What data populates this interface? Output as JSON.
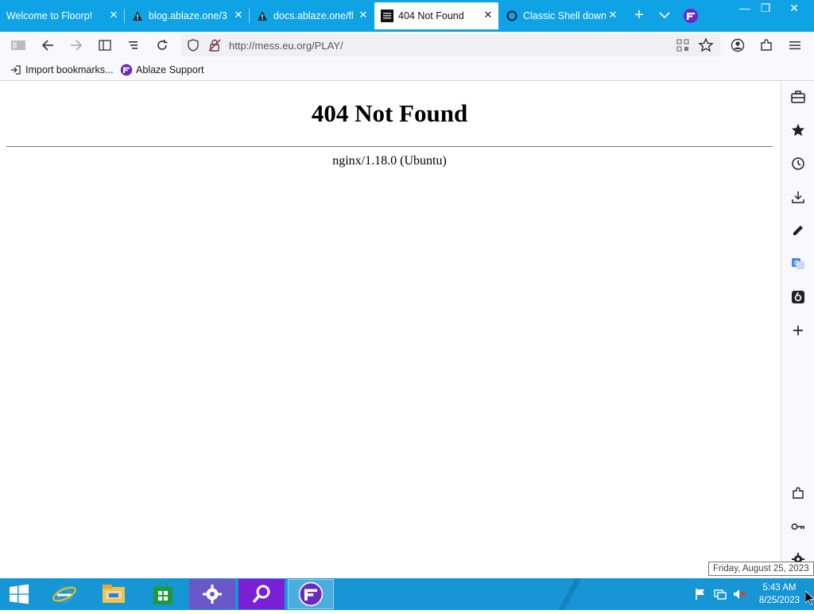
{
  "browser": {
    "tabs": [
      {
        "title": "Welcome to Floorp!",
        "active": false
      },
      {
        "title": "blog.ablaze.one/3",
        "active": false
      },
      {
        "title": "docs.ablaze.one/fl",
        "active": false
      },
      {
        "title": "404 Not Found",
        "active": true
      },
      {
        "title": "Classic Shell downl",
        "active": false
      }
    ],
    "close_glyph": "✕",
    "new_tab_glyph": "+",
    "url": "http://mess.eu.org/PLAY/",
    "bookmarks": [
      {
        "label": "Import bookmarks...",
        "icon": "import-icon"
      },
      {
        "label": "Ablaze Support",
        "icon": "floorp-logo-icon"
      }
    ],
    "window_controls": {
      "minimize": "—",
      "restore": "❐",
      "close": "✕"
    }
  },
  "page": {
    "heading": "404 Not Found",
    "server": "nginx/1.18.0 (Ubuntu)"
  },
  "sidebar": {
    "icons": [
      "toolbox-icon",
      "bookmark-star-icon",
      "history-icon",
      "download-icon",
      "notes-pen-icon",
      "translate-icon",
      "screenshot-icon",
      "add-panel-icon",
      "extensions-icon",
      "passwords-key-icon",
      "settings-gear-icon"
    ]
  },
  "taskbar": {
    "apps": [
      "internet-explorer-icon",
      "file-explorer-icon",
      "store-icon",
      "settings-app-icon",
      "search-app-icon",
      "floorp-browser-icon"
    ],
    "time": "5:43 AM",
    "date": "8/25/2023",
    "tooltip": "Friday, August 25, 2023"
  },
  "colors": {
    "tabbar": "#0fa3e6",
    "taskbar": "#1796d6",
    "accent_purple": "#6a2ac2"
  }
}
